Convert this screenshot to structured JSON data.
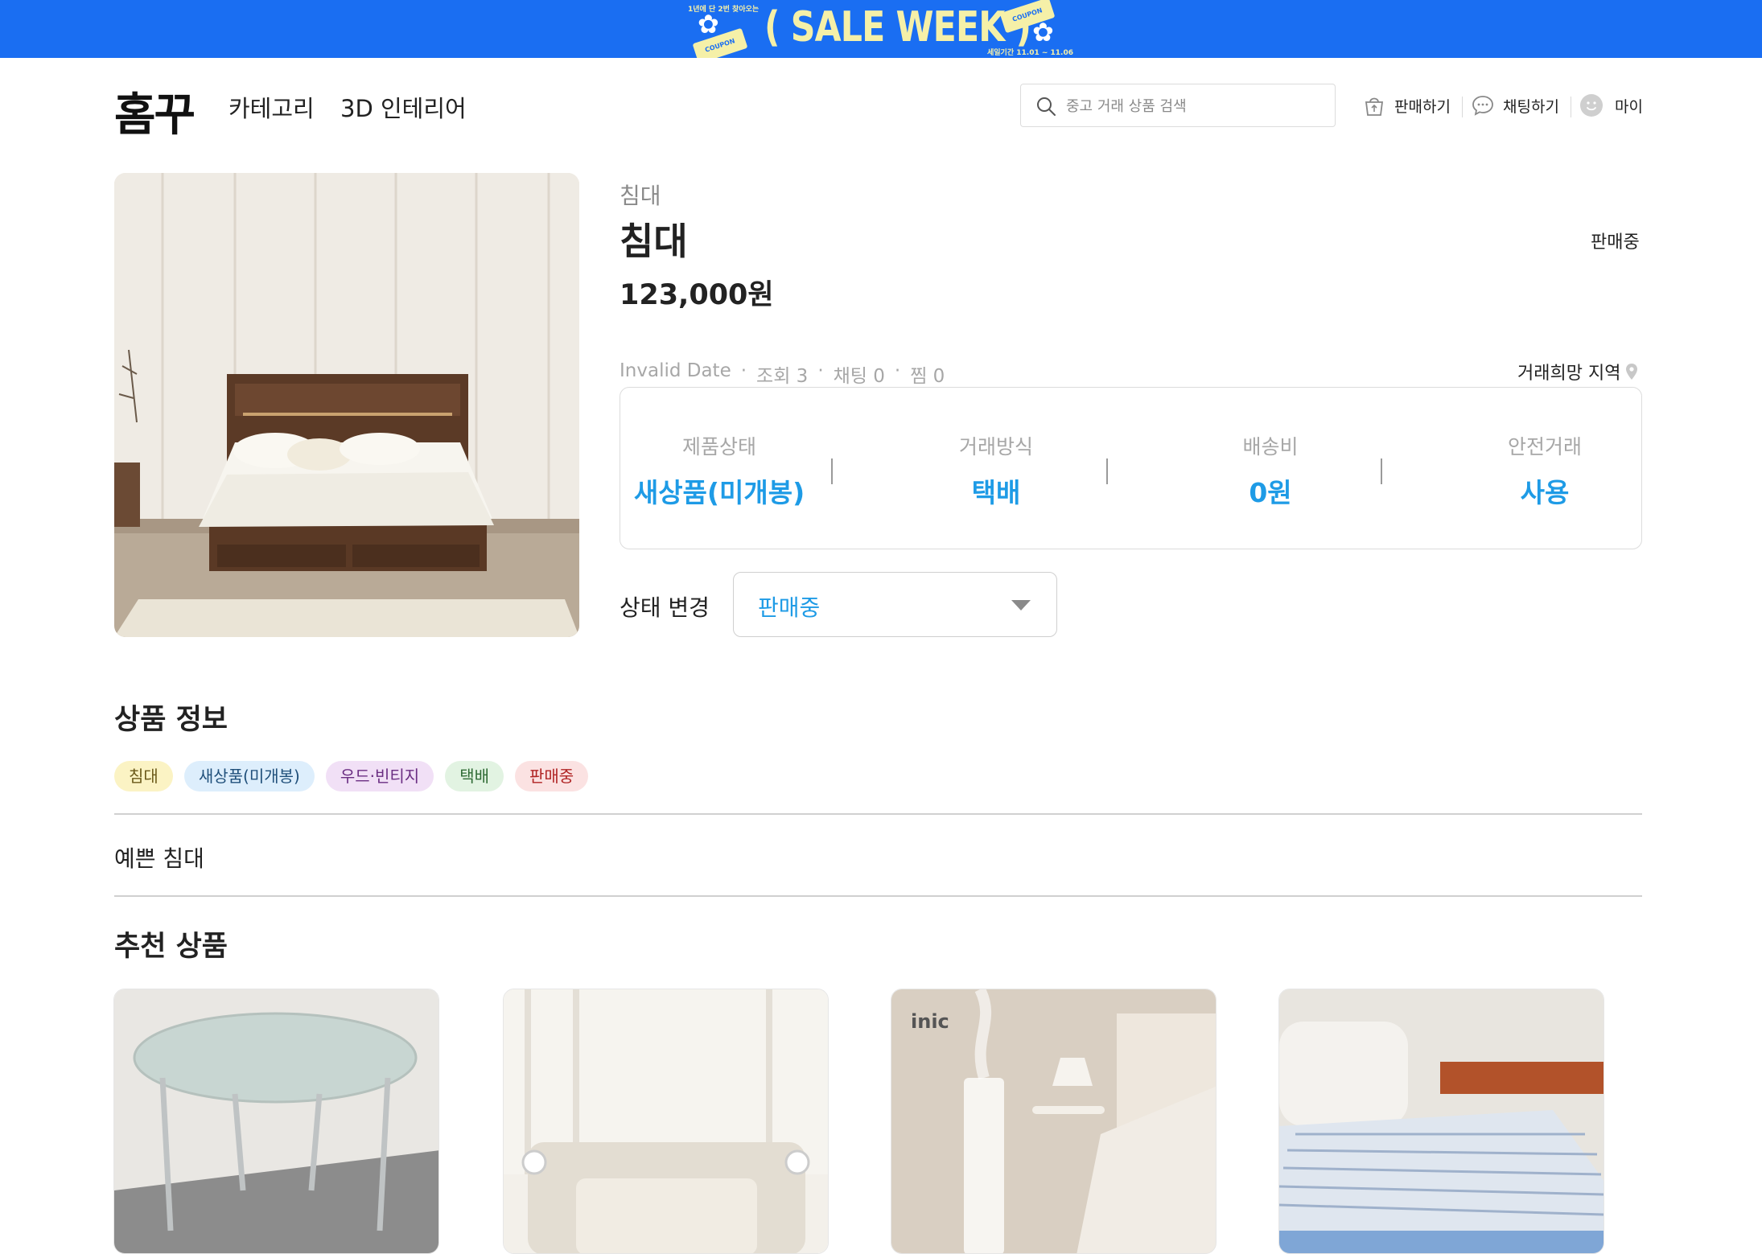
{
  "promo": {
    "title": "( SALE WEEK )",
    "line_top": "1년에 단 2번 찾아오는",
    "coupon_text": "COUPON",
    "period": "세일기간 11.01 ~ 11.06"
  },
  "header": {
    "logo": "홈꾸",
    "nav": [
      "카테고리",
      "3D 인테리어"
    ],
    "search_placeholder": "중고 거래 상품 검색",
    "actions": {
      "sell": "판매하기",
      "chat": "채팅하기",
      "my": "마이"
    }
  },
  "product": {
    "category": "침대",
    "title": "침대",
    "status": "판매중",
    "price": "123,000원",
    "meta": {
      "date": "Invalid Date",
      "views": "조회 3",
      "chats": "채팅 0",
      "likes": "찜 0"
    },
    "region_label": "거래희망 지역",
    "info": [
      {
        "label": "제품상태",
        "value": "새상품(미개봉)"
      },
      {
        "label": "거래방식",
        "value": "택배"
      },
      {
        "label": "배송비",
        "value": "0원"
      },
      {
        "label": "안전거래",
        "value": "사용"
      }
    ],
    "status_change_label": "상태 변경",
    "status_select_value": "판매중"
  },
  "product_info": {
    "title": "상품 정보",
    "tags": [
      {
        "label": "침대",
        "bg": "#fbf3c4",
        "color": "#6b5a1a"
      },
      {
        "label": "새상품(미개봉)",
        "bg": "#ddeefc",
        "color": "#1f4f7a"
      },
      {
        "label": "우드·빈티지",
        "bg": "#f1e0f6",
        "color": "#6a2d82"
      },
      {
        "label": "택배",
        "bg": "#e2f3e2",
        "color": "#2f6b34"
      },
      {
        "label": "판매중",
        "bg": "#fbe2e2",
        "color": "#b02424"
      }
    ],
    "description": "예쁜 침대"
  },
  "recommend": {
    "title": "추천 상품",
    "brand_on_card3": "inic"
  },
  "colors": {
    "banner": "#1a6ef2",
    "accent": "#1e9be6"
  }
}
